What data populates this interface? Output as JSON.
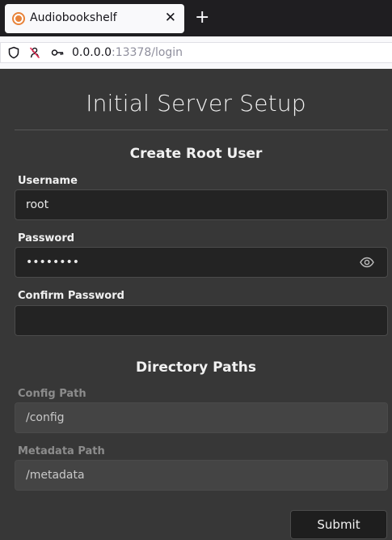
{
  "browser": {
    "tab_title": "Audiobookshelf",
    "tab_close": "✕",
    "new_tab": "+",
    "url_host": "0.0.0.0",
    "url_rest": ":13378/login"
  },
  "page": {
    "title": "Initial Server Setup",
    "root_user": {
      "heading": "Create Root User",
      "username_label": "Username",
      "username_value": "root",
      "password_label": "Password",
      "password_value": "••••••••",
      "confirm_label": "Confirm Password",
      "confirm_value": ""
    },
    "paths": {
      "heading": "Directory Paths",
      "config_label": "Config Path",
      "config_value": "/config",
      "metadata_label": "Metadata Path",
      "metadata_value": "/metadata"
    },
    "submit_label": "Submit"
  },
  "colors": {
    "page_bg": "#373737",
    "input_bg": "#232323",
    "disabled_input_bg": "#444444",
    "favicon": "#e8833a"
  }
}
